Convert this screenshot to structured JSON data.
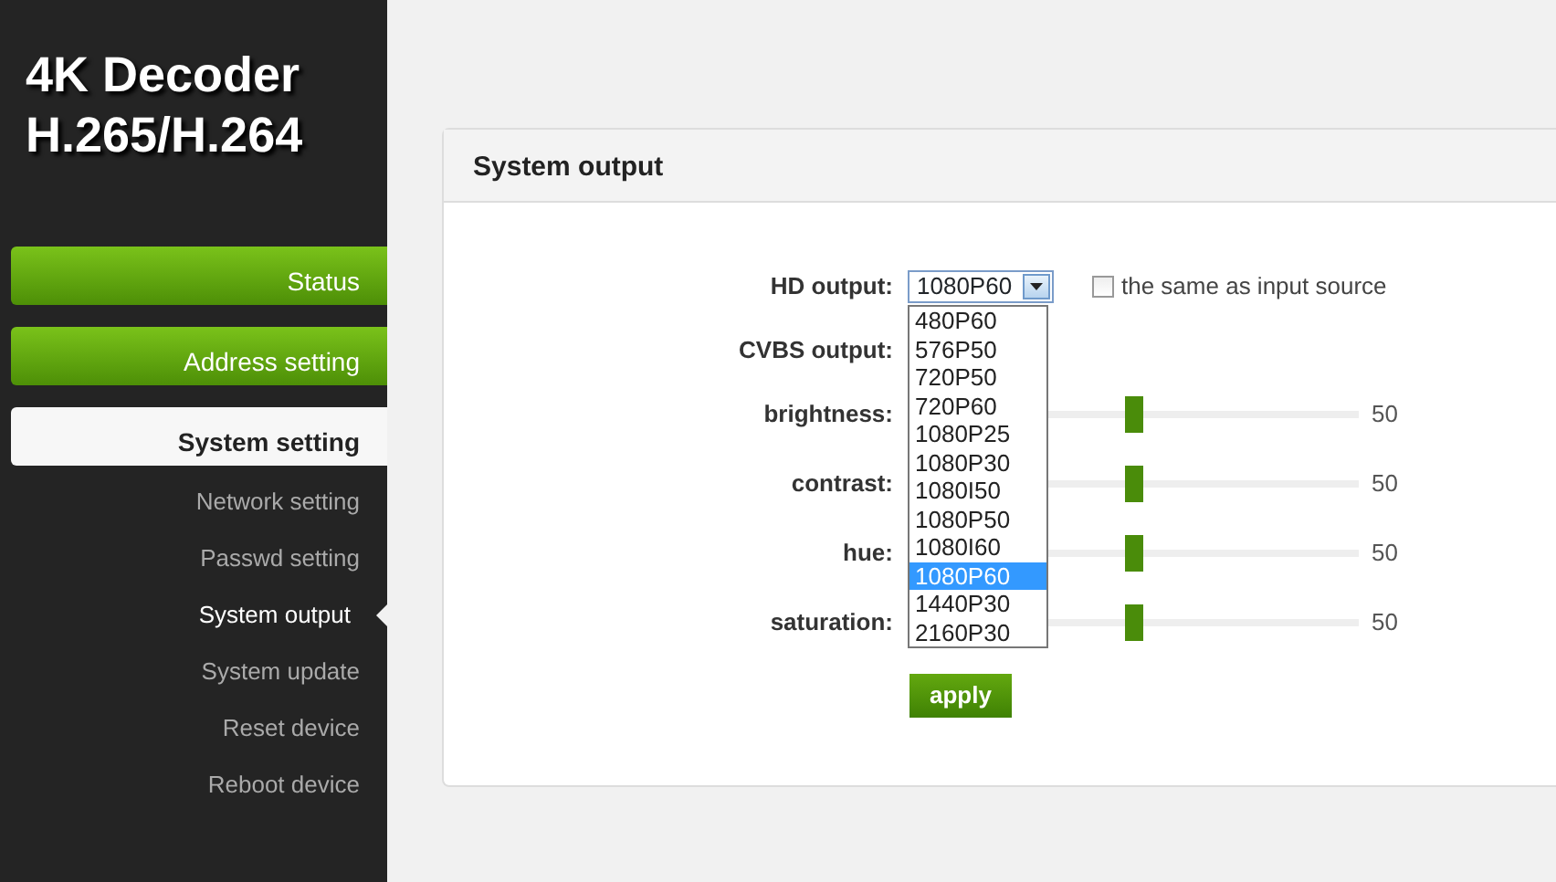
{
  "sidebar": {
    "title_lines": [
      "4K Decoder",
      "H.265/H.264"
    ],
    "items": [
      {
        "label": "Status",
        "kind": "button",
        "selected": false
      },
      {
        "label": "Address setting",
        "kind": "button",
        "selected": false
      },
      {
        "label": "System setting",
        "kind": "section",
        "selected": true
      },
      {
        "label": "Network setting",
        "kind": "sub",
        "selected": false
      },
      {
        "label": "Passwd setting",
        "kind": "sub",
        "selected": false
      },
      {
        "label": "System output",
        "kind": "sub",
        "selected": true
      },
      {
        "label": "System update",
        "kind": "sub",
        "selected": false
      },
      {
        "label": "Reset device",
        "kind": "sub",
        "selected": false
      },
      {
        "label": "Reboot device",
        "kind": "sub",
        "selected": false
      }
    ]
  },
  "panel": {
    "title": "System output",
    "hd_output": {
      "label": "HD output:",
      "value": "1080P60",
      "expanded": true,
      "options": [
        {
          "label": "480P60",
          "selected": false
        },
        {
          "label": "576P50",
          "selected": false
        },
        {
          "label": "720P50",
          "selected": false
        },
        {
          "label": "720P60",
          "selected": false
        },
        {
          "label": "1080P25",
          "selected": false
        },
        {
          "label": "1080P30",
          "selected": false
        },
        {
          "label": "1080I50",
          "selected": false
        },
        {
          "label": "1080P50",
          "selected": false
        },
        {
          "label": "1080I60",
          "selected": false
        },
        {
          "label": "1080P60",
          "selected": true
        },
        {
          "label": "1440P30",
          "selected": false
        },
        {
          "label": "2160P30",
          "selected": false
        }
      ]
    },
    "same_as_input": {
      "label": "the same as input source",
      "checked": false
    },
    "cvbs_output": {
      "label": "CVBS output:"
    },
    "sliders": [
      {
        "label": "brightness:",
        "level": 0.5,
        "reading": "50"
      },
      {
        "label": "contrast:",
        "level": 0.5,
        "reading": "50"
      },
      {
        "label": "hue:",
        "level": 0.5,
        "reading": "50"
      },
      {
        "label": "saturation:",
        "level": 0.5,
        "reading": "50"
      }
    ],
    "apply": "apply"
  }
}
